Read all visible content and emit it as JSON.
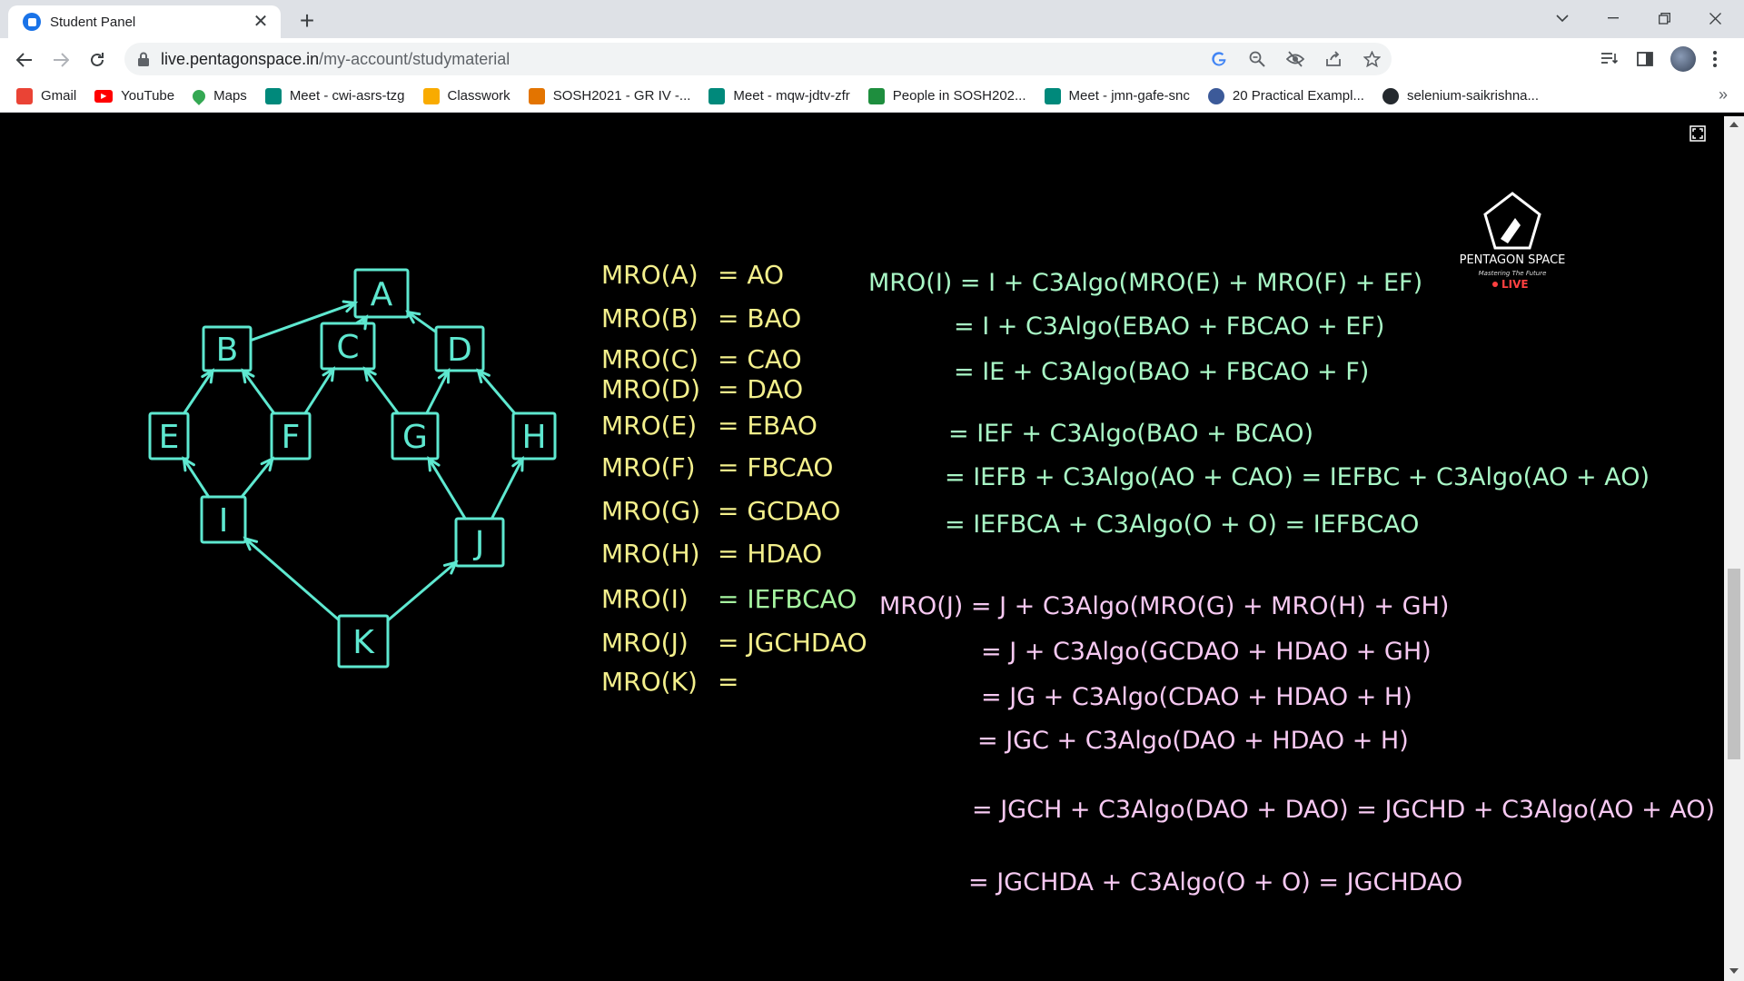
{
  "tab": {
    "title": "Student Panel",
    "close": "✕",
    "new_tab": "+"
  },
  "address": {
    "host": "live.pentagonspace.in",
    "path": "/my-account/studymaterial"
  },
  "bookmarks": [
    {
      "label": "Gmail",
      "icon": "gmail-icon",
      "color": "#ea4335"
    },
    {
      "label": "YouTube",
      "icon": "youtube-icon",
      "color": "#ff0000"
    },
    {
      "label": "Maps",
      "icon": "maps-icon",
      "color": "#34a853"
    },
    {
      "label": "Meet - cwi-asrs-tzg",
      "icon": "meet-icon",
      "color": "#00897b"
    },
    {
      "label": "Classwork",
      "icon": "classroom-icon",
      "color": "#f9ab00"
    },
    {
      "label": "SOSH2021 - GR IV -...",
      "icon": "classroom-icon",
      "color": "#e37400"
    },
    {
      "label": "Meet - mqw-jdtv-zfr",
      "icon": "meet-icon",
      "color": "#00897b"
    },
    {
      "label": "People in SOSH202...",
      "icon": "classroom-icon",
      "color": "#1e8e3e"
    },
    {
      "label": "Meet - jmn-gafe-snc",
      "icon": "meet-icon",
      "color": "#00897b"
    },
    {
      "label": "20 Practical Exampl...",
      "icon": "site-icon",
      "color": "#3c5a99"
    },
    {
      "label": "selenium-saikrishna...",
      "icon": "github-icon",
      "color": "#24292e"
    }
  ],
  "bookmarks_more": "»",
  "board": {
    "nodes": [
      "A",
      "B",
      "C",
      "D",
      "E",
      "F",
      "G",
      "H",
      "I",
      "J",
      "K"
    ],
    "mro_list": [
      {
        "lhs": "MRO(A)",
        "rhs": "= AO"
      },
      {
        "lhs": "MRO(B)",
        "rhs": "= BAO"
      },
      {
        "lhs": "MRO(C)",
        "rhs": "= CAO"
      },
      {
        "lhs": "MRO(D)",
        "rhs": "= DAO"
      },
      {
        "lhs": "MRO(E)",
        "rhs": "= EBAO"
      },
      {
        "lhs": "MRO(F)",
        "rhs": "= FBCAO"
      },
      {
        "lhs": "MRO(G)",
        "rhs": "= GCDAO"
      },
      {
        "lhs": "MRO(H)",
        "rhs": "= HDAO"
      },
      {
        "lhs": "MRO(I)",
        "rhs": "= IEFBCAO"
      },
      {
        "lhs": "MRO(J)",
        "rhs": "= JGCHDAO"
      },
      {
        "lhs": "MRO(K)",
        "rhs": "="
      }
    ],
    "mro_i_steps": [
      "MRO(I) = I + C3Algo(MRO(E) + MRO(F) + EF)",
      "= I + C3Algo(EBAO + FBCAO + EF)",
      "= IE + C3Algo(BAO + FBCAO + F)",
      "= IEF + C3Algo(BAO + BCAO)",
      "= IEFB + C3Algo(AO + CAO) = IEFBC + C3Algo(AO + AO)",
      "= IEFBCA + C3Algo(O + O) = IEFBCAO"
    ],
    "mro_j_steps": [
      "MRO(J) = J + C3Algo(MRO(G) + MRO(H) + GH)",
      "= J + C3Algo(GCDAO + HDAO + GH)",
      "= JG + C3Algo(CDAO + HDAO + H)",
      "= JGC + C3Algo(DAO + HDAO + H)",
      "= JGCH + C3Algo(DAO + DAO) = JGCHD + C3Algo(AO + AO)",
      "= JGCHDA + C3Algo(O + O) = JGCHDAO"
    ],
    "logo": {
      "name": "PENTAGON SPACE",
      "tagline": "Mastering The Future",
      "live": "LIVE"
    },
    "colors": {
      "graph": "#5ee8d0",
      "list": "#f4f08c",
      "highlight": "#a6f5a0",
      "steps_i": "#a9f7c6",
      "steps_j": "#f7c9f2"
    }
  }
}
